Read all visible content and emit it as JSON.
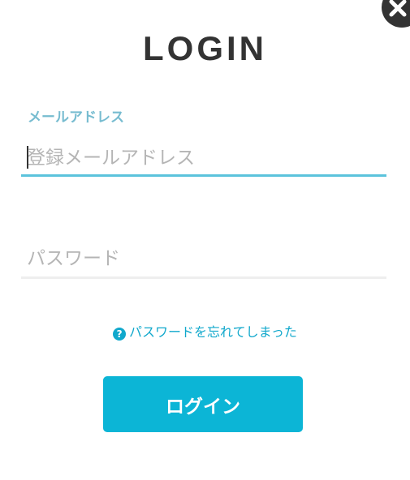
{
  "dialog": {
    "title": "LOGIN",
    "close_icon": "close-icon"
  },
  "email": {
    "label": "メールアドレス",
    "placeholder": "登録メールアドレス",
    "value": ""
  },
  "password": {
    "placeholder": "パスワード",
    "value": ""
  },
  "forgot": {
    "icon": "help-icon",
    "icon_glyph": "?",
    "label": "パスワードを忘れてしまった"
  },
  "submit": {
    "label": "ログイン"
  },
  "colors": {
    "accent": "#0cb5d6",
    "link": "#11a8cc",
    "label": "#77bcd0",
    "title": "#333333",
    "input_active_border": "#5bc3dc",
    "input_border": "#eeeeee"
  }
}
